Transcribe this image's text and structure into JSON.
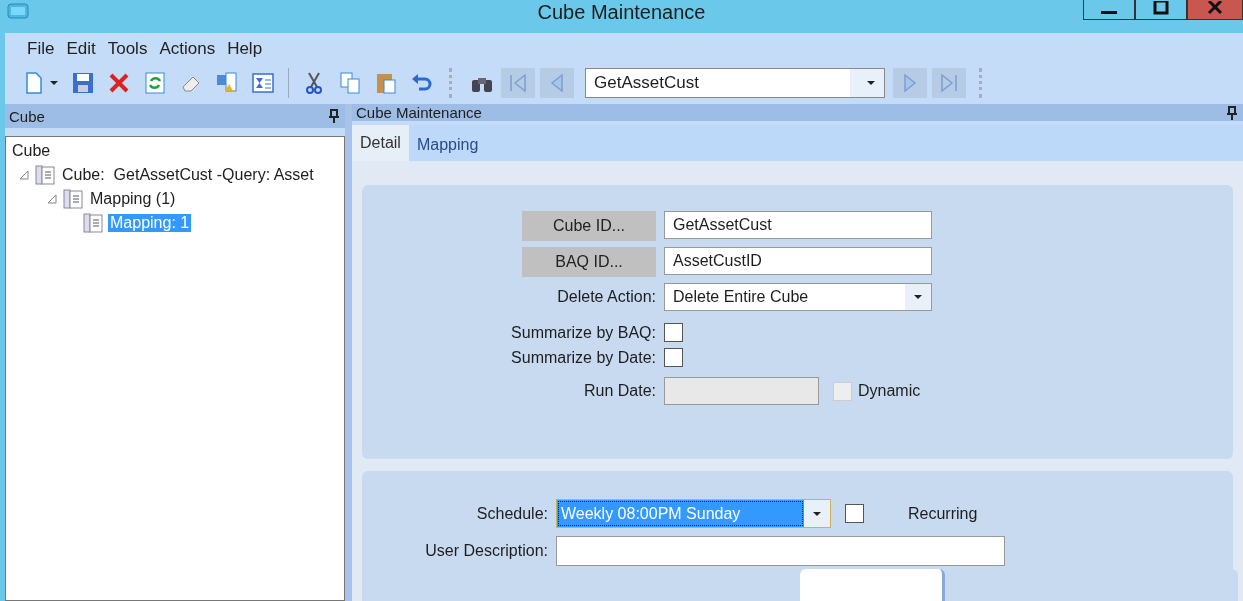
{
  "window": {
    "title": "Cube Maintenance"
  },
  "menu": [
    "File",
    "Edit",
    "Tools",
    "Actions",
    "Help"
  ],
  "toolbar": {
    "record_combo": "GetAssetCust"
  },
  "left_pane": {
    "title": "Cube",
    "tree_root": "Cube",
    "tree": [
      {
        "label": "Cube:  GetAssetCust -Query: Asset",
        "expanded": true,
        "selected": false,
        "children": [
          {
            "label": "Mapping (1)",
            "expanded": true,
            "selected": false,
            "children": [
              {
                "label": "Mapping: 1",
                "selected": true
              }
            ]
          }
        ]
      }
    ]
  },
  "right_pane": {
    "title": "Cube Maintenance",
    "tabs": [
      {
        "label": "Detail",
        "selected": true
      },
      {
        "label": "Mapping",
        "selected": false
      }
    ],
    "detail": {
      "cube_id_button": "Cube ID...",
      "cube_id": "GetAssetCust",
      "baq_id_button": "BAQ ID...",
      "baq_id": "AssetCustID",
      "delete_action_label": "Delete Action:",
      "delete_action": "Delete Entire Cube",
      "summarize_by_baq": {
        "label": "Summarize by BAQ:",
        "checked": false
      },
      "summarize_by_date": {
        "label": "Summarize by Date:",
        "checked": false
      },
      "run_date_label": "Run Date:",
      "run_date_disabled": true,
      "dynamic": {
        "label": "Dynamic",
        "checked": false,
        "disabled": true
      }
    },
    "schedule": {
      "schedule_label": "Schedule:",
      "schedule": "Weekly 08:00PM Sunday",
      "schedule_focused": true,
      "recurring": {
        "label": "Recurring",
        "checked": false
      },
      "user_description_label": "User Description:"
    }
  }
}
